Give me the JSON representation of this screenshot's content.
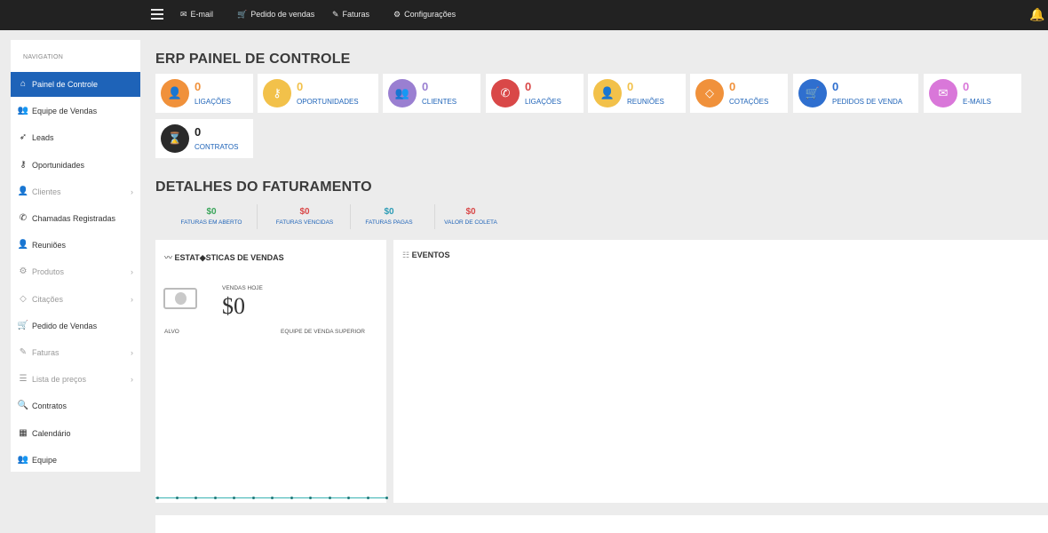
{
  "topbar": {
    "links": [
      {
        "icon": "envelope-icon",
        "glyph": "✉",
        "label": "E-mail"
      },
      {
        "icon": "cart-icon",
        "glyph": "🛒",
        "label": "Pedido de vendas"
      },
      {
        "icon": "edit-icon",
        "glyph": "✎",
        "label": "Faturas"
      },
      {
        "icon": "gear-icon",
        "glyph": "⚙",
        "label": "Configurações"
      }
    ],
    "bell_glyph": "🔔"
  },
  "sidebar": {
    "header": "NAVIGATION",
    "items": [
      {
        "icon": "home-icon",
        "glyph": "⌂",
        "label": "Painel de Controle",
        "active": true,
        "has_sub": false
      },
      {
        "icon": "team-icon",
        "glyph": "👥",
        "label": "Equipe de Vendas",
        "has_sub": false
      },
      {
        "icon": "rocket-icon",
        "glyph": "➶",
        "label": "Leads",
        "has_sub": false
      },
      {
        "icon": "key-icon",
        "glyph": "⚷",
        "label": "Oportunidades",
        "has_sub": false
      },
      {
        "icon": "users-icon",
        "glyph": "👤",
        "label": "Clientes",
        "has_sub": true,
        "muted": true
      },
      {
        "icon": "phone-icon",
        "glyph": "✆",
        "label": "Chamadas Registradas",
        "has_sub": false
      },
      {
        "icon": "user-icon",
        "glyph": "👤",
        "label": "Reuniões",
        "has_sub": false
      },
      {
        "icon": "products-icon",
        "glyph": "⚙",
        "label": "Produtos",
        "has_sub": true,
        "muted": true
      },
      {
        "icon": "tag-icon",
        "glyph": "◇",
        "label": "Citações",
        "has_sub": true,
        "muted": true
      },
      {
        "icon": "cart-icon",
        "glyph": "🛒",
        "label": "Pedido de Vendas",
        "has_sub": false
      },
      {
        "icon": "edit-icon",
        "glyph": "✎",
        "label": "Faturas",
        "has_sub": true,
        "muted": true
      },
      {
        "icon": "list-icon",
        "glyph": "☰",
        "label": "Lista de preços",
        "has_sub": true,
        "muted": true
      },
      {
        "icon": "search-icon",
        "glyph": "🔍",
        "label": "Contratos",
        "has_sub": false
      },
      {
        "icon": "calendar-icon",
        "glyph": "▦",
        "label": "Calendário",
        "has_sub": false
      },
      {
        "icon": "team-icon",
        "glyph": "👥",
        "label": "Equipe",
        "has_sub": false
      }
    ]
  },
  "main": {
    "title": "ERP PAINEL DE CONTROLE",
    "cards": [
      {
        "icon": "user-icon",
        "glyph": "👤",
        "value": "0",
        "label": "LIGAÇÕES",
        "color": "#f0913b"
      },
      {
        "icon": "key-icon",
        "glyph": "⚷",
        "value": "0",
        "label": "OPORTUNIDADES",
        "color": "#f2c14a"
      },
      {
        "icon": "users-icon",
        "glyph": "👥",
        "value": "0",
        "label": "CLIENTES",
        "color": "#9a7fd1"
      },
      {
        "icon": "phone-icon",
        "glyph": "✆",
        "value": "0",
        "label": "LIGAÇÕES",
        "color": "#d94848"
      },
      {
        "icon": "person-icon",
        "glyph": "👤",
        "value": "0",
        "label": "REUNIÕES",
        "color": "#f2c14a"
      },
      {
        "icon": "tag-icon",
        "glyph": "◇",
        "value": "0",
        "label": "COTAÇÕES",
        "color": "#f0913b"
      },
      {
        "icon": "cart-icon",
        "glyph": "🛒",
        "value": "0",
        "label": "PEDIDOS DE VENDA",
        "color": "#2f6fcf"
      },
      {
        "icon": "envelope-icon",
        "glyph": "✉",
        "value": "0",
        "label": "E-MAILS",
        "color": "#d977d9"
      },
      {
        "icon": "hourglass-icon",
        "glyph": "⌛",
        "value": "0",
        "label": "CONTRATOS",
        "color": "#2a2a2a"
      }
    ],
    "billing_title": "DETALHES DO FATURAMENTO",
    "billing": [
      {
        "value": "$0",
        "label": "FATURAS EM ABERTO",
        "color": "#3aa55a"
      },
      {
        "value": "$0",
        "label": "FATURAS VENCIDAS",
        "color": "#d94848"
      },
      {
        "value": "$0",
        "label": "FATURAS PAGAS",
        "color": "#2b9bb5"
      },
      {
        "value": "$0",
        "label": "VALOR DE COLETA",
        "color": "#d94848"
      }
    ],
    "sales_panel": {
      "title": "ESTAT◆STICAS DE VENDAS",
      "today_label": "VENDAS HOJE",
      "today_value": "$0",
      "target_label": "ALVO",
      "top_team_label": "EQUIPE DE VENDA SUPERIOR"
    },
    "events_panel": {
      "title": "EVENTOS"
    }
  }
}
